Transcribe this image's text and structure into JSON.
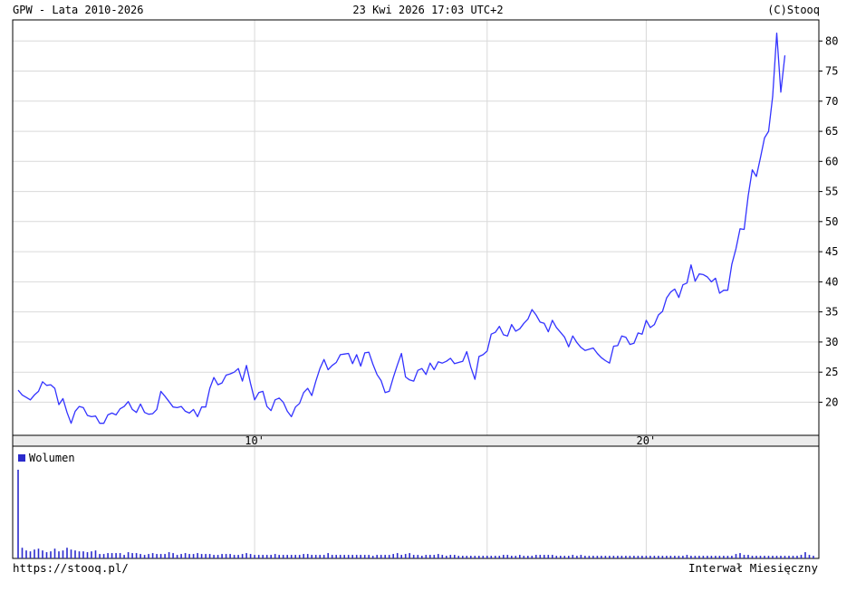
{
  "header": {
    "title": "GPW - Lata 2010-2026",
    "timestamp": "23 Kwi 2026 17:03 UTC+2",
    "copyright": "(C)Stooq"
  },
  "footer": {
    "url": "https://stooq.pl/",
    "interval": "Interwał Miesięczny"
  },
  "colors": {
    "line": "#3333ff",
    "volume": "#2a2acc",
    "grid": "#d9d9d9",
    "frame": "#000000"
  },
  "chart_data": {
    "type": "line",
    "x_range": [
      0,
      195
    ],
    "ylim": [
      14.5,
      83.5
    ],
    "y_ticks": [
      20,
      25,
      30,
      35,
      40,
      45,
      50,
      55,
      60,
      65,
      70,
      75,
      80
    ],
    "x_ticks": [
      {
        "x": 58,
        "label": "10'"
      },
      {
        "x": 154,
        "label": "20'"
      }
    ],
    "x_gridlines": [
      115
    ],
    "grid": true,
    "series": [
      {
        "values": [
          22,
          21.2,
          20.8,
          20.4,
          21.2,
          21.8,
          23.4,
          22.8,
          22.9,
          22.3,
          19.6,
          20.6,
          18.3,
          16.5,
          18.5,
          19.3,
          19.1,
          17.8,
          17.6,
          17.7,
          16.5,
          16.5,
          17.9,
          18.2,
          17.9,
          18.9,
          19.3,
          20.1,
          18.8,
          18.3,
          19.7,
          18.3,
          18,
          18.1,
          18.8,
          21.8,
          21,
          20.1,
          19.2,
          19.1,
          19.3,
          18.5,
          18.2,
          18.8,
          17.6,
          19.2,
          19.2,
          22.3,
          24.1,
          22.9,
          23.2,
          24.5,
          24.7,
          25,
          25.6,
          23.5,
          26.1,
          23.1,
          20.4,
          21.6,
          21.8,
          19.3,
          18.6,
          20.4,
          20.7,
          20,
          18.5,
          17.6,
          19.2,
          19.8,
          21.6,
          22.3,
          21.1,
          23.5,
          25.6,
          27.1,
          25.4,
          26.1,
          26.6,
          27.9,
          28,
          28.1,
          26.4,
          27.9,
          26,
          28.2,
          28.3,
          26.3,
          24.6,
          23.6,
          21.6,
          21.8,
          24.1,
          26.2,
          28.1,
          24.2,
          23.7,
          23.5,
          25.3,
          25.6,
          24.6,
          26.5,
          25.4,
          26.7,
          26.5,
          26.8,
          27.3,
          26.4,
          26.6,
          26.8,
          28.4,
          25.8,
          23.8,
          27.6,
          27.9,
          28.5,
          31.3,
          31.6,
          32.6,
          31.2,
          31,
          32.9,
          31.8,
          32.2,
          33.1,
          33.8,
          35.4,
          34.5,
          33.3,
          33.1,
          31.7,
          33.6,
          32.4,
          31.6,
          30.8,
          29.2,
          31,
          29.9,
          29.1,
          28.6,
          28.8,
          29,
          28.1,
          27.4,
          26.9,
          26.5,
          29.3,
          29.4,
          31,
          30.8,
          29.6,
          29.8,
          31.5,
          31.3,
          33.6,
          32.4,
          32.9,
          34.5,
          35.1,
          37.3,
          38.3,
          38.8,
          37.4,
          39.5,
          39.8,
          42.8,
          40.1,
          41.3,
          41.2,
          40.8,
          40,
          40.6,
          38.1,
          38.6,
          38.6,
          42.9,
          45.5,
          48.8,
          48.7,
          54.3,
          58.6,
          57.5,
          60.6,
          63.9,
          65,
          70.8,
          81.3,
          71.5,
          77.6
        ]
      }
    ]
  },
  "volume": {
    "label": "Wolumen",
    "values": [
      100,
      12,
      9,
      8,
      10,
      11,
      9,
      7,
      8,
      11,
      8,
      9,
      12,
      10,
      9,
      8,
      8,
      7,
      8,
      9,
      5,
      5,
      6,
      6,
      6,
      6,
      4,
      7,
      6,
      6,
      5,
      4,
      5,
      6,
      5,
      5,
      5,
      7,
      6,
      4,
      5,
      6,
      5,
      5,
      6,
      5,
      5,
      5,
      4,
      4,
      5,
      5,
      5,
      4,
      4,
      5,
      6,
      5,
      4,
      4,
      4,
      4,
      4,
      5,
      4,
      4,
      4,
      4,
      4,
      4,
      5,
      5,
      4,
      4,
      4,
      4,
      6,
      4,
      4,
      4,
      4,
      4,
      4,
      4,
      4,
      4,
      4,
      3,
      4,
      4,
      4,
      4,
      5,
      6,
      4,
      5,
      6,
      4,
      4,
      3,
      4,
      4,
      4,
      5,
      4,
      3,
      4,
      4,
      3,
      3,
      3,
      3,
      3,
      3,
      3,
      3,
      3,
      3,
      3,
      4,
      4,
      3,
      3,
      4,
      3,
      3,
      3,
      4,
      4,
      4,
      4,
      4,
      3,
      3,
      3,
      3,
      4,
      3,
      4,
      3,
      3,
      3,
      3,
      3,
      3,
      3,
      3,
      3,
      3,
      3,
      3,
      3,
      3,
      3,
      3,
      3,
      3,
      3,
      3,
      3,
      3,
      3,
      3,
      3,
      4,
      3,
      3,
      3,
      3,
      3,
      3,
      3,
      3,
      3,
      3,
      3,
      5,
      6,
      4,
      4,
      3,
      3,
      3,
      3,
      3,
      3,
      3,
      3,
      3,
      3,
      3,
      3,
      4,
      7,
      4,
      3
    ]
  }
}
